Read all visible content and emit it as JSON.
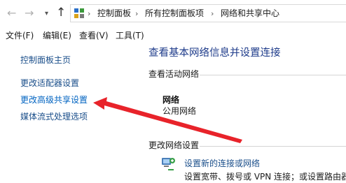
{
  "address_bar": {
    "back_icon": "arrow-left-icon",
    "forward_icon": "arrow-right-icon",
    "recent_icon": "chevron-down-icon",
    "up_icon": "arrow-up-icon",
    "location_icon": "control-panel-icon",
    "crumbs": [
      "控制面板",
      "所有控制面板项",
      "网络和共享中心"
    ],
    "separator": "›"
  },
  "menu": {
    "items": [
      "文件(F)",
      "编辑(E)",
      "查看(V)",
      "工具(T)"
    ]
  },
  "left_pane": {
    "links": [
      "控制面板主页",
      "更改适配器设置",
      "更改高级共享设置",
      "媒体流式处理选项"
    ]
  },
  "main": {
    "title": "查看基本网络信息并设置连接",
    "active_networks_label": "查看活动网络",
    "network_name": "网络",
    "network_type": "公用网络",
    "change_settings_label": "更改网络设置",
    "task_icon": "new-connection-icon",
    "task_link": "设置新的连接或网络",
    "task_desc": "设置宽带、拨号或 VPN 连接；或设置路由器"
  },
  "colors": {
    "link": "#1a4e8a",
    "title": "#1e3b8a",
    "annotation_arrow": "#e8232a"
  }
}
